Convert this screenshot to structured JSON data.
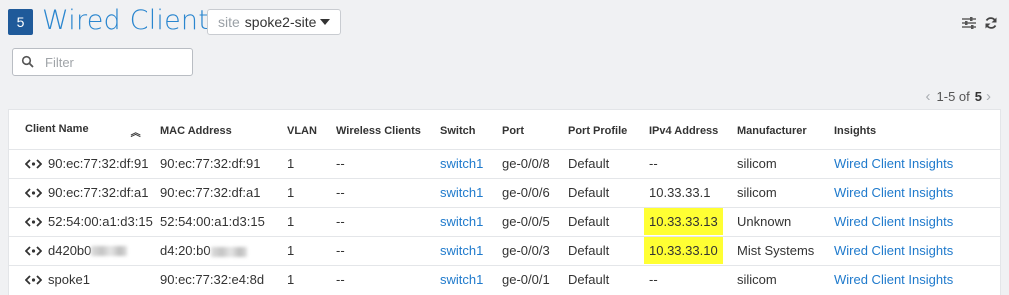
{
  "header": {
    "count": "5",
    "title": "Wired Clients",
    "site_prefix": "site",
    "site_value": "spoke2-site"
  },
  "icons": {
    "settings": "sliders-icon",
    "refresh": "refresh-icon",
    "search": "search-icon",
    "wired": "wired-client-icon"
  },
  "filter": {
    "placeholder": "Filter"
  },
  "pager": {
    "prev": "‹",
    "range": "1-5 of",
    "total": "5",
    "next": "›"
  },
  "table": {
    "columns": [
      "Client Name",
      "MAC Address",
      "VLAN",
      "Wireless Clients",
      "Switch",
      "Port",
      "Port Profile",
      "IPv4 Address",
      "Manufacturer",
      "Insights"
    ],
    "rows": [
      {
        "name": "90:ec:77:32:df:91",
        "mac": "90:ec:77:32:df:91",
        "vlan": "1",
        "wireless": "--",
        "switch": "switch1",
        "port": "ge-0/0/8",
        "profile": "Default",
        "ipv4": "--",
        "manufacturer": "silicom",
        "insights": "Wired Client Insights"
      },
      {
        "name": "90:ec:77:32:df:a1",
        "mac": "90:ec:77:32:df:a1",
        "vlan": "1",
        "wireless": "--",
        "switch": "switch1",
        "port": "ge-0/0/6",
        "profile": "Default",
        "ipv4": "10.33.33.1",
        "manufacturer": "silicom",
        "insights": "Wired Client Insights"
      },
      {
        "name": "52:54:00:a1:d3:15",
        "mac": "52:54:00:a1:d3:15",
        "vlan": "1",
        "wireless": "--",
        "switch": "switch1",
        "port": "ge-0/0/5",
        "profile": "Default",
        "ipv4": "10.33.33.13",
        "manufacturer": "Unknown",
        "insights": "Wired Client Insights"
      },
      {
        "name": "d420b0",
        "mac": "d4:20:b0",
        "vlan": "1",
        "wireless": "--",
        "switch": "switch1",
        "port": "ge-0/0/3",
        "profile": "Default",
        "ipv4": "10.33.33.10",
        "manufacturer": "Mist Systems",
        "insights": "Wired Client Insights"
      },
      {
        "name": "spoke1",
        "mac": "90:ec:77:32:e4:8d",
        "vlan": "1",
        "wireless": "--",
        "switch": "switch1",
        "port": "ge-0/0/1",
        "profile": "Default",
        "ipv4": "--",
        "manufacturer": "silicom",
        "insights": "Wired Client Insights"
      }
    ]
  },
  "colors": {
    "title": "#2a86cf",
    "badge": "#1f5a9a",
    "link": "#1f7acc",
    "highlight": "#ffff33"
  }
}
